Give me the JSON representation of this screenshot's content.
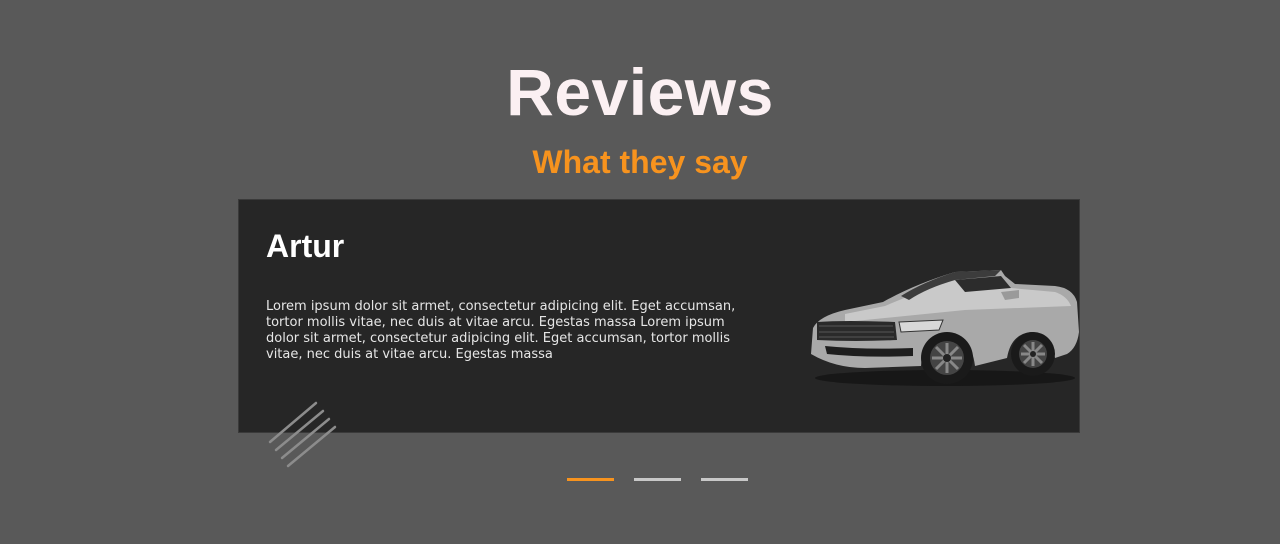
{
  "header": {
    "title": "Reviews",
    "subtitle": "What they say"
  },
  "review": {
    "name": "Artur",
    "text": "Lorem ipsum dolor sit armet, consectetur adipicing elit. Eget accumsan, tortor mollis vitae, nec duis at vitae arcu. Egestas massa Lorem ipsum dolor sit armet, consectetur adipicing elit. Eget accumsan, tortor mollis vitae, nec duis at vitae arcu. Egestas massa",
    "image": "silver-convertible-car"
  },
  "pagination": {
    "count": 3,
    "active_index": 0
  },
  "colors": {
    "background": "#595959",
    "card": "#262626",
    "accent": "#f7931e",
    "title": "#fbf0f2"
  }
}
